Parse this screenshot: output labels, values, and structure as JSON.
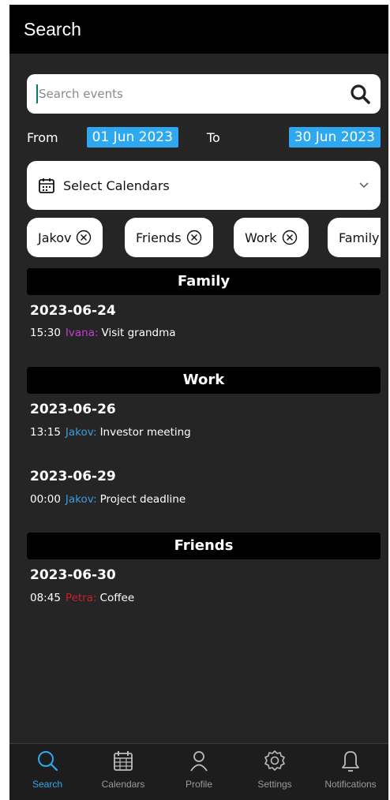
{
  "appbar": {
    "title": "Search"
  },
  "search": {
    "placeholder": "Search events",
    "value": ""
  },
  "date_range": {
    "from_label": "From",
    "from_value": "01 Jun 2023",
    "to_label": "To",
    "to_value": "30 Jun 2023"
  },
  "calendar_select": {
    "label": "Select Calendars"
  },
  "chips": [
    {
      "label": "Jakov"
    },
    {
      "label": "Friends"
    },
    {
      "label": "Work"
    },
    {
      "label": "Family"
    }
  ],
  "sections": [
    {
      "title": "Family",
      "events": [
        {
          "date": "2023-06-24",
          "time": "15:30",
          "who": "Ivana:",
          "who_color": "#c43fd0",
          "title": "Visit grandma"
        }
      ]
    },
    {
      "title": "Work",
      "events": [
        {
          "date": "2023-06-26",
          "time": "13:15",
          "who": "Jakov:",
          "who_color": "#3a9de0",
          "title": "Investor meeting"
        },
        {
          "date": "2023-06-29",
          "time": "00:00",
          "who": "Jakov:",
          "who_color": "#3a9de0",
          "title": "Project deadline"
        }
      ]
    },
    {
      "title": "Friends",
      "events": [
        {
          "date": "2023-06-30",
          "time": "08:45",
          "who": "Petra:",
          "who_color": "#c8202a",
          "title": "Coffee"
        }
      ]
    }
  ],
  "bottom_nav": [
    {
      "label": "Search",
      "icon": "search-icon",
      "active": true
    },
    {
      "label": "Calendars",
      "icon": "calendar-icon",
      "active": false
    },
    {
      "label": "Profile",
      "icon": "person-icon",
      "active": false
    },
    {
      "label": "Settings",
      "icon": "gear-icon",
      "active": false
    },
    {
      "label": "Notifications",
      "icon": "bell-icon",
      "active": false
    }
  ],
  "colors": {
    "accent": "#2ea8f0",
    "background": "#252525",
    "appbar": "#000000"
  }
}
